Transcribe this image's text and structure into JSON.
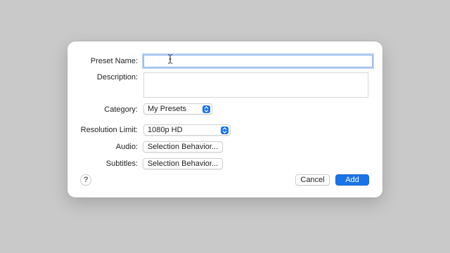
{
  "dialog": {
    "preset_name": {
      "label": "Preset Name:",
      "value": ""
    },
    "description": {
      "label": "Description:",
      "value": ""
    },
    "category": {
      "label": "Category:",
      "selected": "My Presets"
    },
    "resolution_limit": {
      "label": "Resolution Limit:",
      "selected": "1080p HD"
    },
    "audio": {
      "label": "Audio:",
      "button_label": "Selection Behavior..."
    },
    "subtitles": {
      "label": "Subtitles:",
      "button_label": "Selection Behavior..."
    },
    "help_label": "?",
    "cancel_label": "Cancel",
    "add_label": "Add"
  },
  "colors": {
    "accent": "#1a73e8",
    "focus_ring": "#b9d1f4",
    "backdrop": "#c9c9c9"
  },
  "icons": {
    "popup_stepper": "chevron-up-down-icon",
    "text_cursor": "i-beam-cursor-icon"
  }
}
